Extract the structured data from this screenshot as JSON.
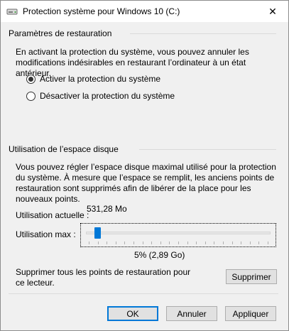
{
  "window": {
    "title": "Protection système pour Windows 10 (C:)",
    "close_glyph": "✕"
  },
  "restore_settings": {
    "heading": "Paramètres de restauration",
    "description": "En activant la protection du système, vous pouvez annuler les modifications indésirables en restaurant l’ordinateur à un état antérieur.",
    "options": [
      {
        "label": "Activer la protection du système",
        "checked": true
      },
      {
        "label": "Désactiver la protection du système",
        "checked": false
      }
    ]
  },
  "disk_usage": {
    "heading": "Utilisation de l’espace disque",
    "description": "Vous pouvez régler l’espace disque maximal utilisé pour la protection du système. À mesure que l’espace se remplit, les anciens points de restauration sont supprimés afin de libérer de la place pour les nouveaux points.",
    "current_label": "Utilisation actuelle :",
    "current_value": "531,28 Mo",
    "max_label": "Utilisation max :",
    "slider_fraction": 0.05,
    "slider_value_text": "5% (2,89 Go)"
  },
  "delete_section": {
    "text": "Supprimer tous les points de restauration pour ce lecteur.",
    "button_label": "Supprimer"
  },
  "footer": {
    "ok_label": "OK",
    "cancel_label": "Annuler",
    "apply_label": "Appliquer"
  },
  "colors": {
    "accent": "#0078d7",
    "window_bg": "#f0f0f0"
  }
}
